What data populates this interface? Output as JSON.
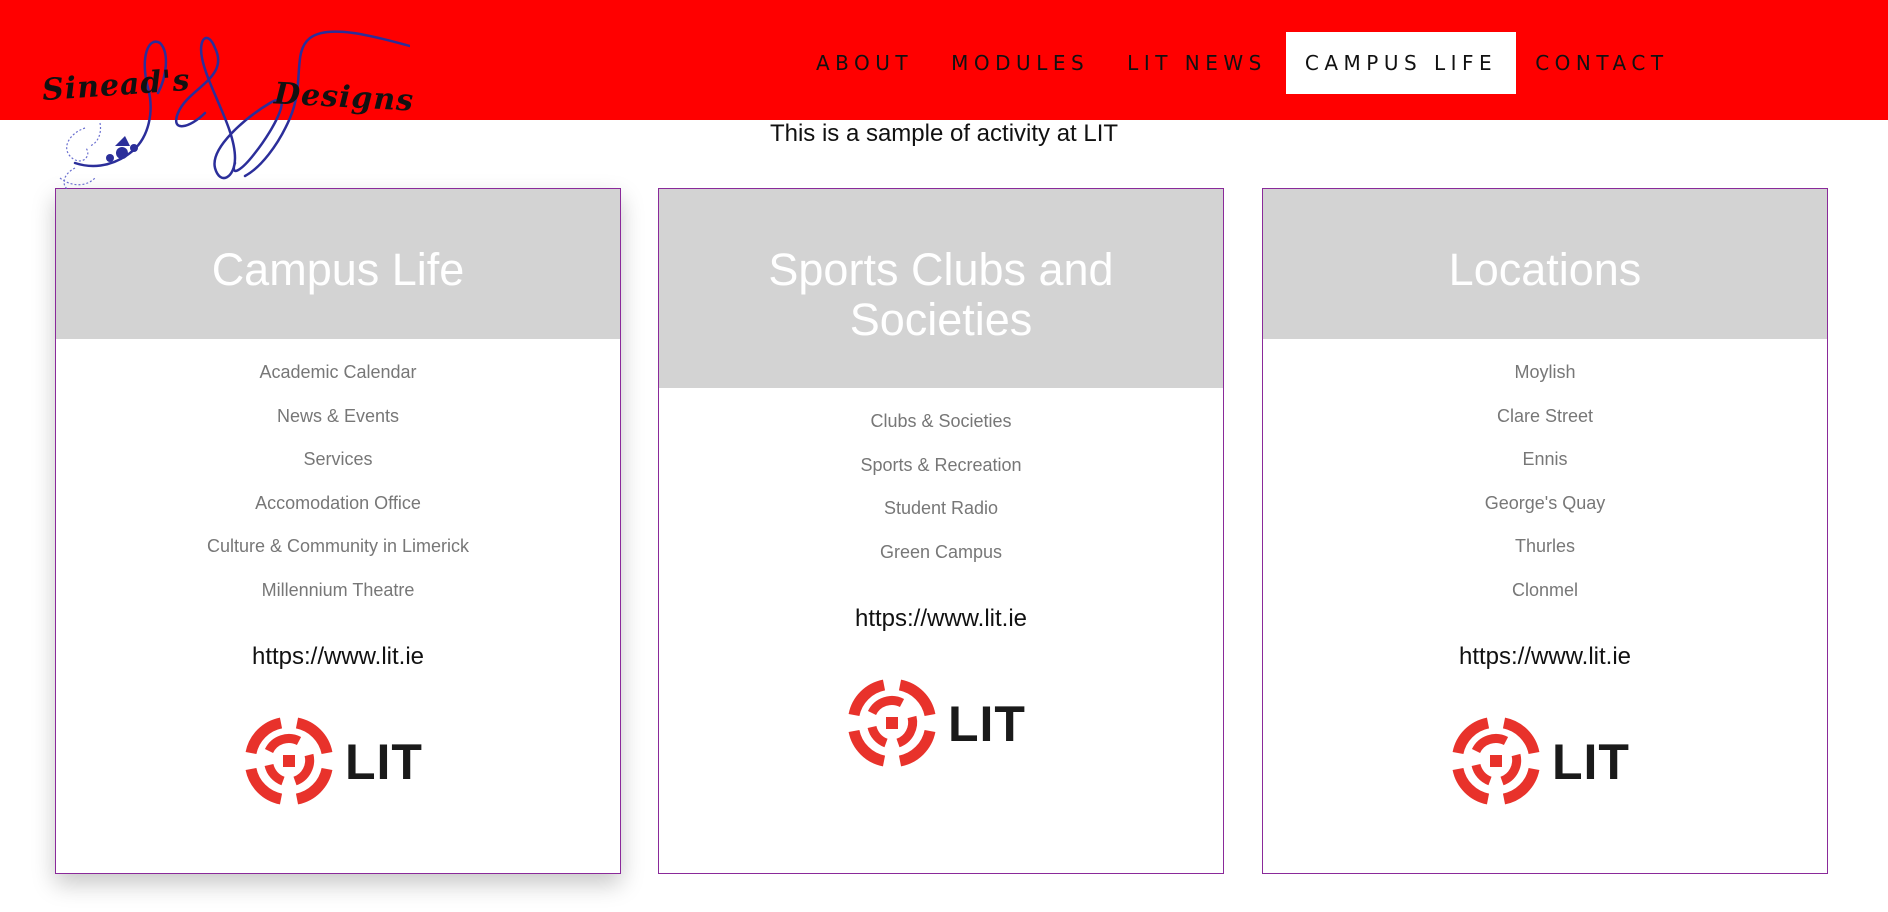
{
  "brand": {
    "logo_left": "Sinead's",
    "logo_right": "Designs",
    "logo_colors": {
      "script": "#2b2e9a",
      "text": "#111111"
    }
  },
  "nav": {
    "items": [
      {
        "label": "ABOUT"
      },
      {
        "label": "MODULES"
      },
      {
        "label": "LIT NEWS"
      },
      {
        "label": "CAMPUS LIFE",
        "active": true
      },
      {
        "label": "CONTACT"
      }
    ]
  },
  "intro": "This is a sample of activity at LIT",
  "cards": [
    {
      "title": "Campus Life",
      "items": [
        "Academic Calendar",
        "News & Events",
        "Services",
        "Accomodation Office",
        "Culture & Community in Limerick",
        "Millennium Theatre"
      ],
      "url": "https://www.lit.ie",
      "logo_text": "LIT"
    },
    {
      "title": "Sports Clubs and Societies",
      "items": [
        "Clubs & Societies",
        "Sports & Recreation",
        "Student Radio",
        "Green Campus"
      ],
      "url": "https://www.lit.ie",
      "logo_text": "LIT"
    },
    {
      "title": "Locations",
      "items": [
        "Moylish",
        "Clare Street",
        "Ennis",
        "George's Quay",
        "Thurles",
        "Clonmel"
      ],
      "url": "https://www.lit.ie",
      "logo_text": "LIT"
    }
  ],
  "colors": {
    "navbar": "#ff0000",
    "card_header": "#d3d3d3",
    "card_border": "#8a2a9a",
    "lit_red": "#e8322b"
  }
}
